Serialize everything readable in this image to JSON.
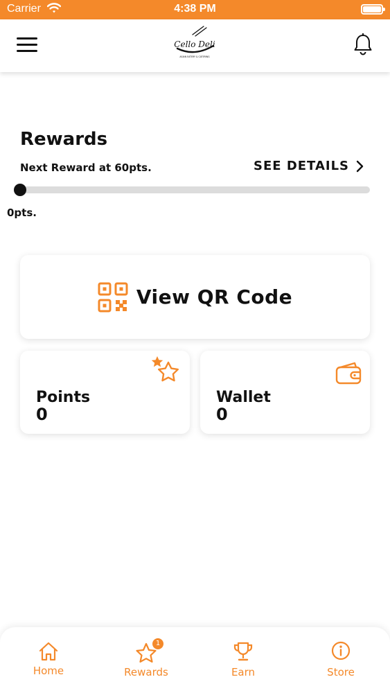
{
  "status_bar": {
    "carrier": "Carrier",
    "time": "4:38 PM"
  },
  "header": {
    "logo_text": "Cello Deli",
    "logo_subtext": "ASIAN EATERY & CATERING"
  },
  "rewards": {
    "title": "Rewards",
    "next_reward": "Next Reward at 60pts.",
    "see_details": "SEE DETAILS",
    "current_points_label": "0pts.",
    "progress_fraction": 0
  },
  "qr": {
    "label": "View QR Code"
  },
  "points": {
    "label": "Points",
    "value": "0"
  },
  "wallet": {
    "label": "Wallet",
    "value": "0"
  },
  "tabs": [
    {
      "label": "Home",
      "icon": "home-icon"
    },
    {
      "label": "Rewards",
      "icon": "star-icon",
      "badge": "1"
    },
    {
      "label": "Earn",
      "icon": "trophy-icon"
    },
    {
      "label": "Store",
      "icon": "info-icon"
    }
  ],
  "colors": {
    "accent": "#F4892A",
    "text": "#111111",
    "track": "#DCDCDC"
  }
}
